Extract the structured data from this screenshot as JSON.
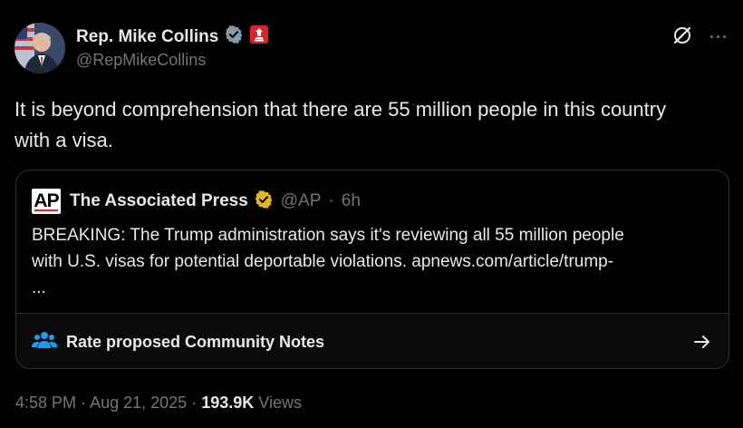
{
  "author": {
    "name": "Rep. Mike Collins",
    "handle": "@RepMikeCollins",
    "verified_color": "#829aab",
    "affiliate_badge_color": "#d6262c"
  },
  "tweet": {
    "text": "It is beyond comprehension that there are 55 million people in this country with a visa."
  },
  "quote": {
    "logo_text": "AP",
    "name": "The Associated Press",
    "verified_color": "#e2b719",
    "handle": "@AP",
    "separator": "·",
    "time": "6h",
    "text_line1": "BREAKING: The Trump administration says it's reviewing all 55 million people",
    "text_line2": "with U.S. visas for potential deportable violations. apnews.com/article/trump-",
    "text_line3": "..."
  },
  "community_notes": {
    "label": "Rate proposed Community Notes",
    "icon": "people-icon",
    "icon_color": "#1d9bf0"
  },
  "meta": {
    "time": "4:58 PM",
    "sep1": "·",
    "date": "Aug 21, 2025",
    "sep2": "·",
    "views_count": "193.9K",
    "views_label": "Views"
  }
}
